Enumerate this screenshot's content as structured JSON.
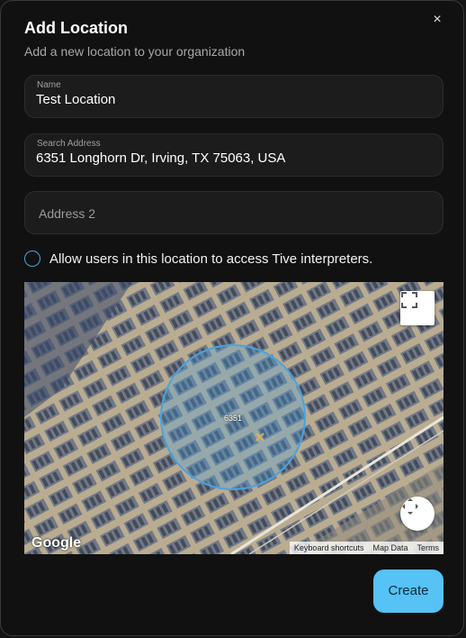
{
  "dialog": {
    "title": "Add Location",
    "subtitle": "Add a new location to your organization",
    "close_icon": "×"
  },
  "fields": {
    "name": {
      "label": "Name",
      "value": "Test Location"
    },
    "search_address": {
      "label": "Search Address",
      "value": "6351 Longhorn Dr, Irving, TX 75063, USA"
    },
    "address2": {
      "placeholder": "Address 2"
    }
  },
  "access_option": {
    "label": "Allow users in this location to access Tive interpreters.",
    "checked": false
  },
  "map": {
    "marker_label": "6351",
    "google_logo": "Google",
    "attribution": [
      "Keyboard shortcuts",
      "Map Data",
      "Terms"
    ],
    "radius_color": "#4aa3df"
  },
  "actions": {
    "create_label": "Create",
    "create_color": "#56c2f5"
  }
}
